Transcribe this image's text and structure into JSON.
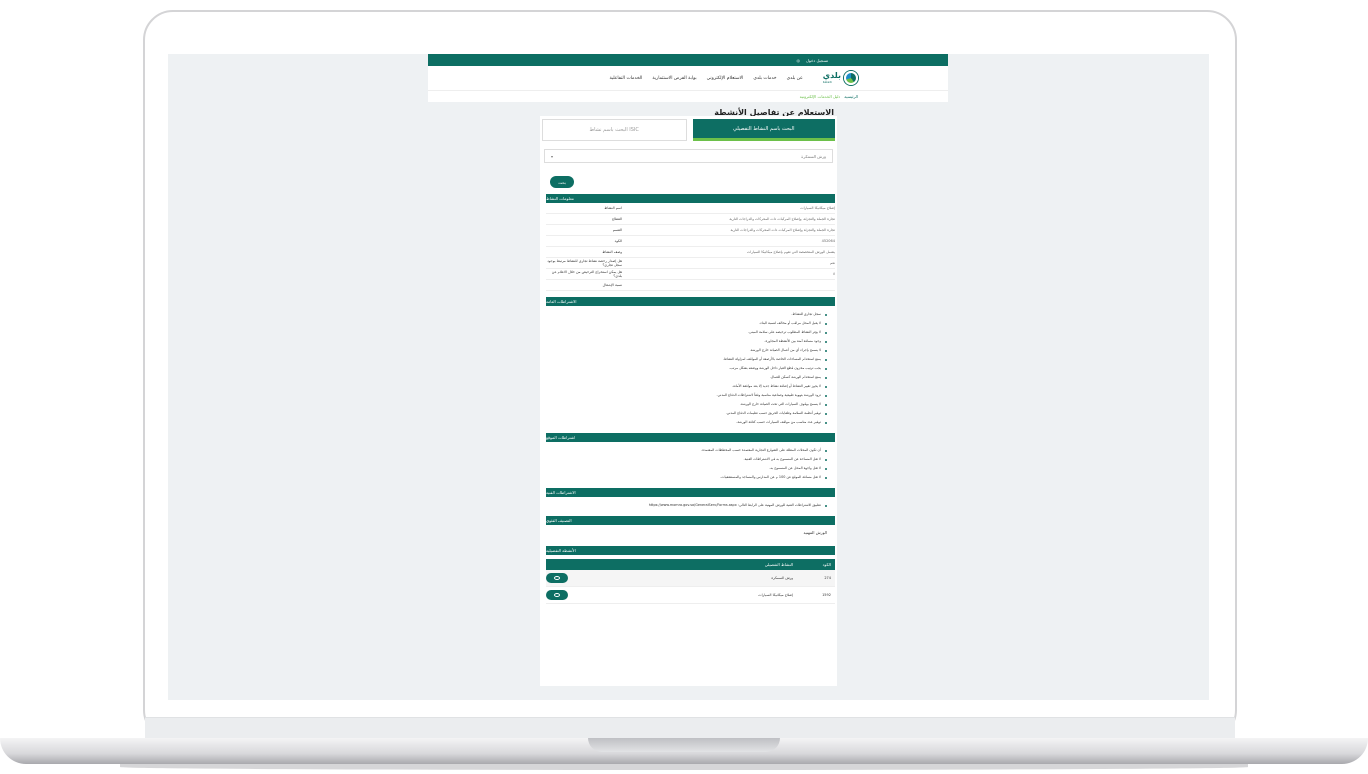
{
  "topbar": {
    "links": [
      "تسجيل دخول",
      "◎"
    ]
  },
  "header": {
    "logo_text": "بلدي",
    "logo_sub": "baladi",
    "nav": [
      "عن بلدي",
      "خدمات بلدي",
      "الاستعلام الإلكتروني",
      "بوابة الفرص الاستثمارية",
      "الخدمات التفاعلية"
    ]
  },
  "breadcrumb": {
    "home": "الرئيسية",
    "current": "دليل الخدمات الإلكترونية"
  },
  "page": {
    "title": "الاستعلام عن تفاصيل الأنشطة"
  },
  "tabs": {
    "active": "البحث باسم النشاط التفصيلي",
    "inactive": "البحث باسم نشاط ISIC"
  },
  "search": {
    "selected_value": "ورش السمكرة",
    "button": "بحث"
  },
  "activity_info": {
    "header": "معلومات النشاط",
    "rows": [
      {
        "k": "اسم النشاط",
        "v": "إصلاح ميكانيكا السيارات"
      },
      {
        "k": "القطاع",
        "v": "تجارة الجملة والتجزئة، وإصلاح المركبات ذات المحركات والدراجات النارية"
      },
      {
        "k": "القسم",
        "v": "تجارة الجملة والتجزئة وإصلاح المركبات ذات المحركات والدراجات النارية"
      },
      {
        "k": "الكود",
        "v": "452064"
      },
      {
        "k": "وصف النشاط",
        "v": "يشمل الورش المتخصصة التي تقوم بإصلاح ميكانيكا السيارات"
      },
      {
        "k": "هل إصدار رخصة نشاط تجاري للنشاط مرتبط بوجود سجل تجاري؟",
        "v": "نعم"
      },
      {
        "k": "هل يمكن استخراج الترخيص من خلال الاعلام عن بلدي؟",
        "v": "لا"
      },
      {
        "k": "نسبة الإشغال",
        "v": ""
      }
    ]
  },
  "general_requirements": {
    "header": "الاشتراطات العامة",
    "items": [
      "سجل تجاري للنشاط.",
      "لا يقبل المحل مراقب أو مخالف لنسبة البناء.",
      "لا يؤثر النشاط المطلوب ترخيصه على سلامة المبنى.",
      "وجود مسافة آمنة بين الأنشطة المجاورة.",
      "لا يسمح بإجراء أي من أعمال الصيانة خارج الورشة.",
      "يمنع استخدام المساحات الخاصة بالأرصفة أو المواقف لمزاولة النشاط.",
      "يجب ترتيب مخزون قطع الغيار داخل الورشة ووضعه بشكل مرتب.",
      "يمنع استخدام الورشة كسكن للعمال.",
      "لا يجوز تغيير النشاط أو إضافة نشاط جديد إلا بعد موافقة الأمانة.",
      "تزود الورشة بتهوية طبيعية وصناعية مناسبة وفقاً لاشتراطات الدفاع المدني.",
      "لا يسمح بوقوف السيارات التي تحت الصيانة خارج الورشة.",
      "توفير أنظمة السلامة وطفايات الحريق حسب تعليمات الدفاع المدني.",
      "توفير عدد مناسب من مواقف السيارات حسب كثافة الورشة."
    ]
  },
  "location_requirements": {
    "header": "اشتراطات الموقع",
    "items": [
      "أن تكون المحلات المطلة على الشوارع التجارية المعتمدة حسب المخططات المعتمدة.",
      "لا تقل المساحة عن المسموح به في الاشتراطات الفنية.",
      "لا تقل واجهة المحل عن المسموح به.",
      "لا تقل مسافة الموقع عن 100 م عن المدارس والمساجد والمستشفيات."
    ]
  },
  "technical_requirements": {
    "header": "الاشتراطات الفنية",
    "items": [
      "تطبيق الاشتراطات الفنية للورش المهنية على الرابط التالي: https://www.momra.gov.sa/GeneralServ/Forms.aspx"
    ]
  },
  "classification": {
    "header": "التصنيف الفئوي",
    "value": "الورش المهنية"
  },
  "detailed_activities": {
    "header": "الأنشطة التفصيلية",
    "columns": {
      "code": "الكود",
      "name": "النشاط التفصيلي"
    },
    "rows": [
      {
        "code": "274",
        "name": "ورش السمكرة"
      },
      {
        "code": "1592",
        "name": "إصلاح ميكانيكا السيارات"
      }
    ]
  }
}
